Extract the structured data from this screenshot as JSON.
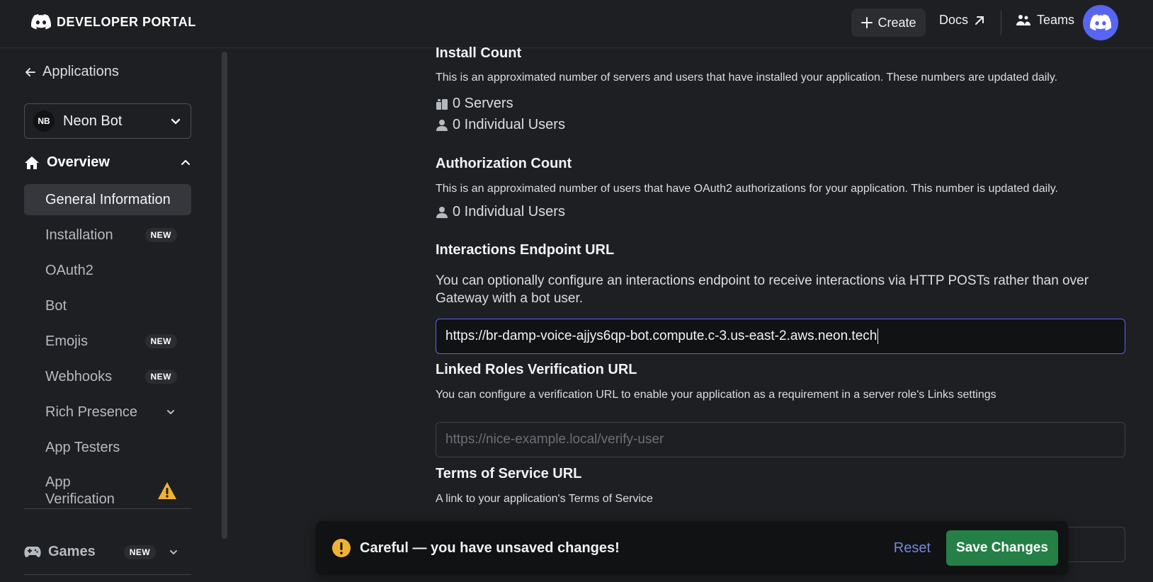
{
  "header": {
    "logo_text": "DEVELOPER PORTAL",
    "create_label": "Create",
    "docs_label": "Docs",
    "teams_label": "Teams"
  },
  "sidebar": {
    "back_label": "Applications",
    "app_initials": "NB",
    "app_name": "Neon Bot",
    "overview_label": "Overview",
    "items": [
      {
        "label": "General Information"
      },
      {
        "label": "Installation",
        "badge": "NEW"
      },
      {
        "label": "OAuth2"
      },
      {
        "label": "Bot"
      },
      {
        "label": "Emojis",
        "badge": "NEW"
      },
      {
        "label": "Webhooks",
        "badge": "NEW"
      },
      {
        "label": "Rich Presence"
      },
      {
        "label": "App Testers"
      },
      {
        "label_line1": "App",
        "label_line2": "Verification"
      }
    ],
    "games_label": "Games",
    "games_badge": "NEW"
  },
  "main": {
    "install_count": {
      "title": "Install Count",
      "desc": "This is an approximated number of servers and users that have installed your application. These numbers are updated daily.",
      "servers": "0 Servers",
      "users": "0 Individual Users"
    },
    "auth_count": {
      "title": "Authorization Count",
      "desc": "This is an approximated number of users that have OAuth2 authorizations for your application. This number is updated daily.",
      "users": "0 Individual Users"
    },
    "interactions": {
      "title": "Interactions Endpoint URL",
      "desc": "You can optionally configure an interactions endpoint to receive interactions via HTTP POSTs rather than over Gateway with a bot user.",
      "value": "https://br-damp-voice-ajjys6qp-bot.compute.c-3.us-east-2.aws.neon.tech"
    },
    "linked_roles": {
      "title": "Linked Roles Verification URL",
      "desc": "You can configure a verification URL to enable your application as a requirement in a server role's Links settings",
      "placeholder": "https://nice-example.local/verify-user"
    },
    "tos": {
      "title": "Terms of Service URL",
      "desc": "A link to your application's Terms of Service"
    }
  },
  "unsaved": {
    "message": "Careful — you have unsaved changes!",
    "reset_label": "Reset",
    "save_label": "Save Changes"
  },
  "colors": {
    "accent": "#5865f2",
    "save_green": "#248046",
    "warning": "#f0b232",
    "reset_link": "#7289da"
  }
}
